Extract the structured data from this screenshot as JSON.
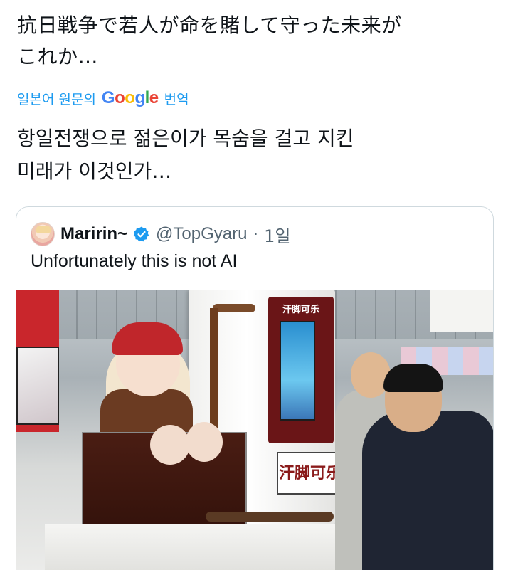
{
  "post": {
    "original_line1": "抗日戦争で若人が命を賭して守った未来が",
    "original_line2": "これか…",
    "translate_prefix": "일본어 원문의",
    "translate_google": "Google",
    "translate_suffix": "번역",
    "translated_line1": "항일전쟁으로 젊은이가 목숨을 걸고 지킨",
    "translated_line2": "미래가 이것인가…"
  },
  "quote": {
    "author_name": "Maririn~",
    "handle": "@TopGyaru",
    "separator": "·",
    "time": "1일",
    "body": "Unfortunately this is not AI",
    "image": {
      "screen_label": "汗脚可乐",
      "sign_text": "汗脚可乐"
    }
  },
  "colors": {
    "link_blue": "#1d9bf0",
    "verified_blue": "#1d9bf0",
    "text_primary": "#0f1419",
    "text_secondary": "#536471"
  }
}
